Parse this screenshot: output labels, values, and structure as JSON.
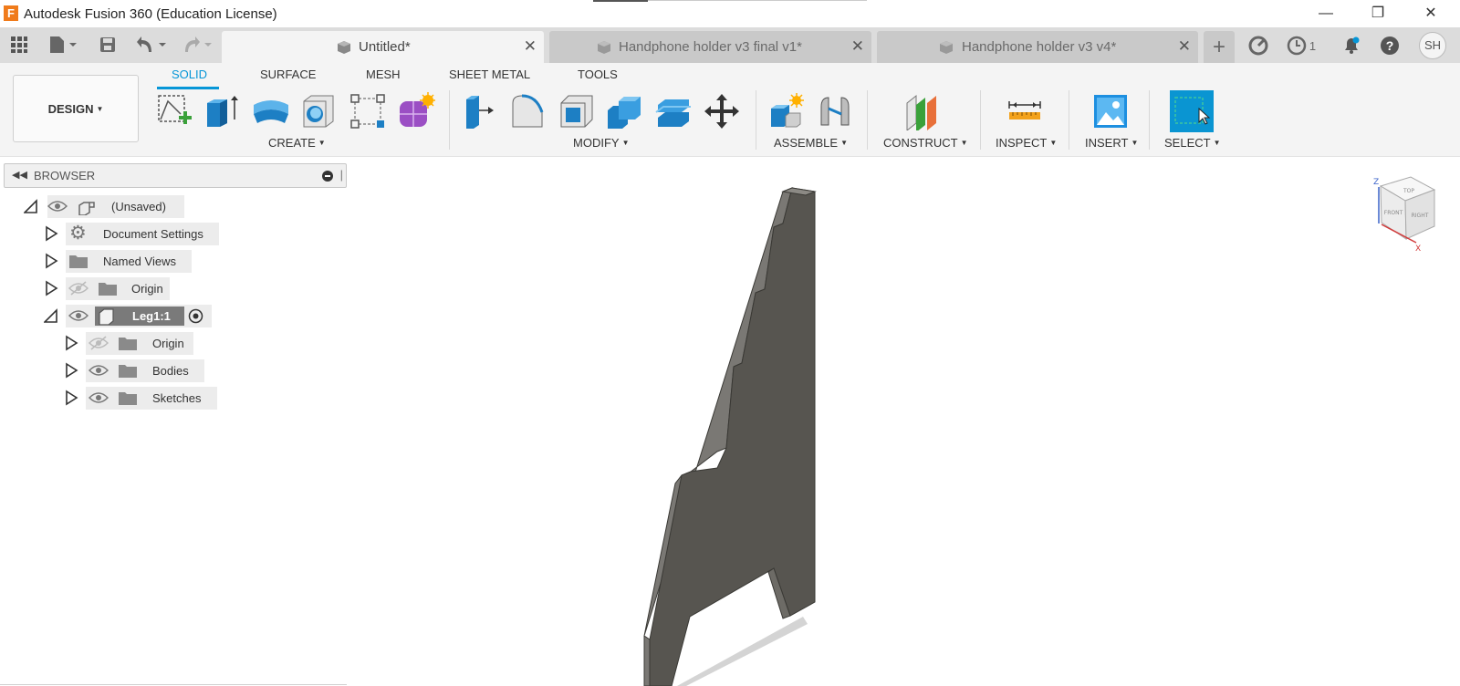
{
  "app": {
    "logo_letter": "F",
    "title": "Autodesk Fusion 360 (Education License)",
    "window_controls": {
      "minimize": "—",
      "restore": "❐",
      "close": "✕"
    }
  },
  "tabs": [
    {
      "label": "Untitled*",
      "active": true
    },
    {
      "label": "Handphone holder v3 final v1*",
      "active": false
    },
    {
      "label": "Handphone holder v3 v4*",
      "active": false
    }
  ],
  "tabbar": {
    "new_tab": "+",
    "jobs_count": "1",
    "user_initials": "SH"
  },
  "toolbar": {
    "workspace": "DESIGN",
    "workspace_tabs": [
      "SOLID",
      "SURFACE",
      "MESH",
      "SHEET METAL",
      "TOOLS"
    ],
    "active_workspace_tab": "SOLID",
    "groups": {
      "create": "CREATE",
      "modify": "MODIFY",
      "assemble": "ASSEMBLE",
      "construct": "CONSTRUCT",
      "inspect": "INSPECT",
      "insert": "INSERT",
      "select": "SELECT"
    }
  },
  "browser": {
    "title": "BROWSER",
    "items": [
      {
        "label": "(Unsaved)",
        "level": 0,
        "expanded": true,
        "visible": true
      },
      {
        "label": "Document Settings",
        "level": 1,
        "expanded": false
      },
      {
        "label": "Named Views",
        "level": 1,
        "expanded": false
      },
      {
        "label": "Origin",
        "level": 1,
        "expanded": false,
        "visible": false
      },
      {
        "label": "Leg1:1",
        "level": 1,
        "expanded": true,
        "visible": true,
        "active": true
      },
      {
        "label": "Origin",
        "level": 2,
        "expanded": false,
        "visible": false
      },
      {
        "label": "Bodies",
        "level": 2,
        "expanded": false,
        "visible": true
      },
      {
        "label": "Sketches",
        "level": 2,
        "expanded": false,
        "visible": true
      }
    ]
  },
  "viewcube": {
    "top": "TOP",
    "front": "FRONT",
    "right": "RIGHT",
    "axis_z": "Z",
    "axis_x": "X"
  },
  "colors": {
    "accent": "#0696d7",
    "body_face": "#575550",
    "body_edge": "#3a3935",
    "select_tool": "#0a95d2"
  }
}
